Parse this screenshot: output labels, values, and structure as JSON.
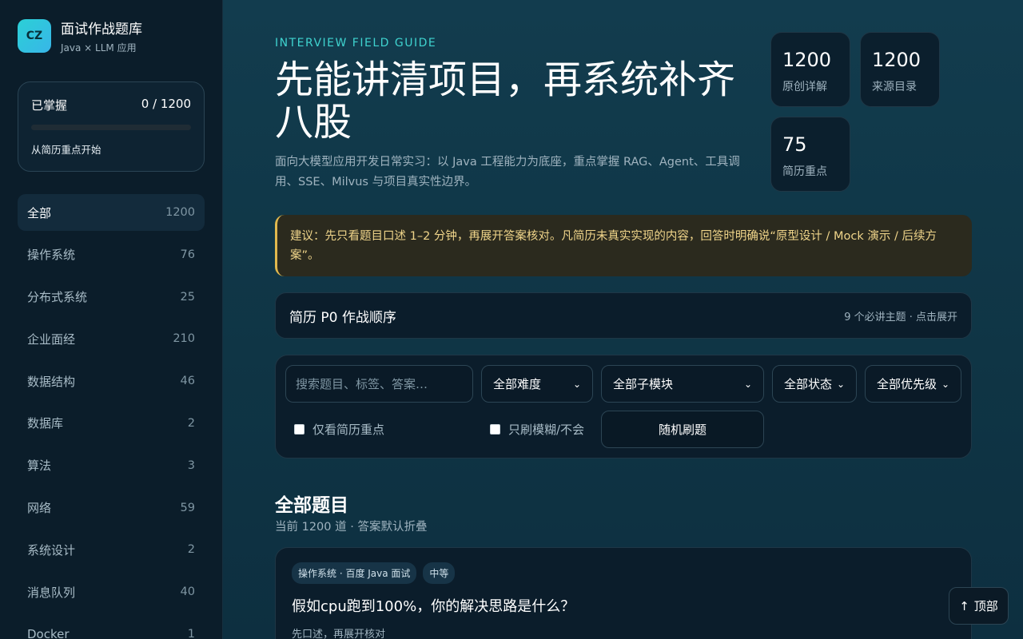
{
  "brand": {
    "logo_text": "CZ",
    "title": "面试作战题库",
    "subtitle": "Java × LLM 应用"
  },
  "progress": {
    "label": "已掌握",
    "value_text": "0 / 1200",
    "fraction": 0.0,
    "hint": "从简历重点开始"
  },
  "categories": [
    {
      "label": "全部",
      "count": "1200",
      "active": true
    },
    {
      "label": "操作系统",
      "count": "76"
    },
    {
      "label": "分布式系统",
      "count": "25"
    },
    {
      "label": "企业面经",
      "count": "210"
    },
    {
      "label": "数据结构",
      "count": "46"
    },
    {
      "label": "数据库",
      "count": "2"
    },
    {
      "label": "算法",
      "count": "3"
    },
    {
      "label": "网络",
      "count": "59"
    },
    {
      "label": "系统设计",
      "count": "2"
    },
    {
      "label": "消息队列",
      "count": "40"
    },
    {
      "label": "Docker",
      "count": "1"
    }
  ],
  "hero": {
    "eyebrow": "INTERVIEW FIELD GUIDE",
    "title": "先能讲清项目，再系统补齐八股",
    "description": "面向大模型应用开发日常实习：以 Java 工程能力为底座，重点掌握 RAG、Agent、工具调用、SSE、Milvus 与项目真实性边界。"
  },
  "stats": [
    {
      "number": "1200",
      "label": "原创详解"
    },
    {
      "number": "1200",
      "label": "来源目录"
    },
    {
      "number": "75",
      "label": "简历重点"
    }
  ],
  "advice": "建议：先只看题目口述 1–2 分钟，再展开答案核对。凡简历未真实实现的内容，回答时明确说“原型设计 / Mock 演示 / 后续方案”。",
  "p0": {
    "title": "简历 P0 作战顺序",
    "meta": "9 个必讲主题 · 点击展开"
  },
  "filters": {
    "search_placeholder": "搜索题目、标签、答案…",
    "difficulty": "全部难度",
    "submodule": "全部子模块",
    "status": "全部状态",
    "priority": "全部优先级",
    "resume_only": "仅看简历重点",
    "fuzzy_only": "只刷模糊/不会",
    "random_button": "随机刷题"
  },
  "section": {
    "title": "全部题目",
    "subtitle": "当前 1200 道 · 答案默认折叠"
  },
  "question": {
    "tag_category": "操作系统 · 百度 Java 面试",
    "tag_level": "中等",
    "title": "假如cpu跑到100%，你的解决思路是什么？",
    "hint": "先口述，再展开核对"
  },
  "top_button": {
    "arrow": "↑",
    "label": "顶部"
  },
  "colors": {
    "accent": "#38b6e8",
    "eyebrow": "#3fd3cf",
    "advice_border": "#e0b84e",
    "advice_text": "#f0d58a"
  }
}
